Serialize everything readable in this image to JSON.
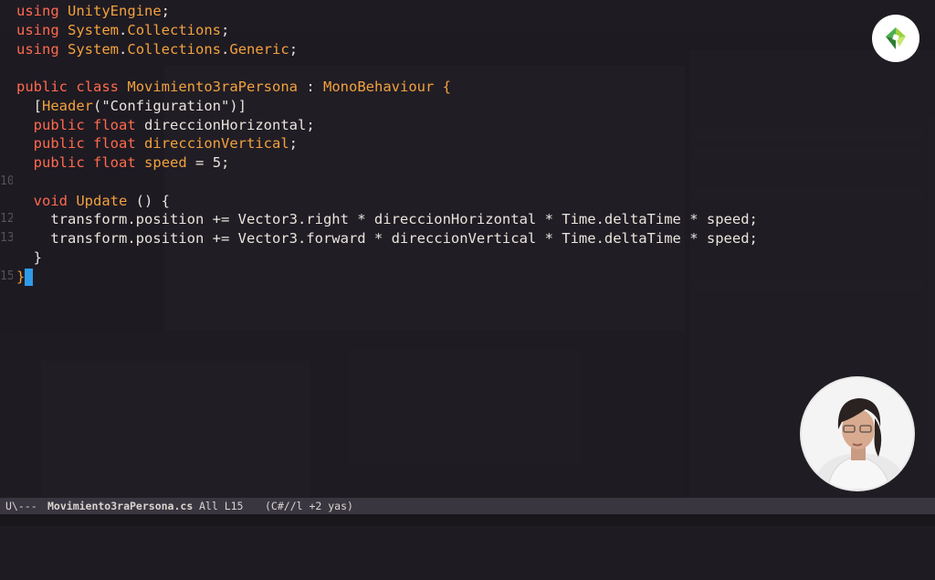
{
  "code_lines": [
    [
      {
        "t": "using",
        "c": "kw"
      },
      {
        "t": " ",
        "c": "nm"
      },
      {
        "t": "UnityEngine",
        "c": "ty"
      },
      {
        "t": ";",
        "c": "nm"
      }
    ],
    [
      {
        "t": "using",
        "c": "kw"
      },
      {
        "t": " ",
        "c": "nm"
      },
      {
        "t": "System",
        "c": "ty"
      },
      {
        "t": ".",
        "c": "nm"
      },
      {
        "t": "Collections",
        "c": "ty"
      },
      {
        "t": ";",
        "c": "nm"
      }
    ],
    [
      {
        "t": "using",
        "c": "kw"
      },
      {
        "t": " ",
        "c": "nm"
      },
      {
        "t": "System",
        "c": "ty"
      },
      {
        "t": ".",
        "c": "nm"
      },
      {
        "t": "Collections",
        "c": "ty"
      },
      {
        "t": ".",
        "c": "nm"
      },
      {
        "t": "Generic",
        "c": "ty"
      },
      {
        "t": ";",
        "c": "nm"
      }
    ],
    [],
    [
      {
        "t": "public",
        "c": "kw"
      },
      {
        "t": " ",
        "c": "nm"
      },
      {
        "t": "class",
        "c": "kw"
      },
      {
        "t": " ",
        "c": "nm"
      },
      {
        "t": "Movimiento3raPersona",
        "c": "ty"
      },
      {
        "t": " : ",
        "c": "nm"
      },
      {
        "t": "MonoBehaviour",
        "c": "ty"
      },
      {
        "t": " {",
        "c": "ty"
      }
    ],
    [
      {
        "t": "  [",
        "c": "nm"
      },
      {
        "t": "Header",
        "c": "ty"
      },
      {
        "t": "(\"Configuration\")]",
        "c": "nm"
      }
    ],
    [
      {
        "t": "  ",
        "c": "nm"
      },
      {
        "t": "public",
        "c": "kw"
      },
      {
        "t": " ",
        "c": "nm"
      },
      {
        "t": "float",
        "c": "kw"
      },
      {
        "t": " direccionHorizontal;",
        "c": "nm"
      }
    ],
    [
      {
        "t": "  ",
        "c": "nm"
      },
      {
        "t": "public",
        "c": "kw"
      },
      {
        "t": " ",
        "c": "nm"
      },
      {
        "t": "float",
        "c": "kw"
      },
      {
        "t": " ",
        "c": "nm"
      },
      {
        "t": "direccionVertical",
        "c": "var"
      },
      {
        "t": ";",
        "c": "nm"
      }
    ],
    [
      {
        "t": "  ",
        "c": "nm"
      },
      {
        "t": "public",
        "c": "kw"
      },
      {
        "t": " ",
        "c": "nm"
      },
      {
        "t": "float",
        "c": "kw"
      },
      {
        "t": " ",
        "c": "nm"
      },
      {
        "t": "speed",
        "c": "var"
      },
      {
        "t": " = 5;",
        "c": "nm"
      }
    ],
    [],
    [
      {
        "t": "  ",
        "c": "nm"
      },
      {
        "t": "void",
        "c": "kw"
      },
      {
        "t": " ",
        "c": "nm"
      },
      {
        "t": "Update",
        "c": "ty"
      },
      {
        "t": " () {",
        "c": "nm"
      }
    ],
    [
      {
        "t": "    transform.position += Vector3.right * direccionHorizontal * Time.deltaTime * speed;",
        "c": "nm"
      }
    ],
    [
      {
        "t": "    transform.position += Vector3.forward * direccionVertical * Time.deltaTime * speed;",
        "c": "nm"
      }
    ],
    [
      {
        "t": "  }",
        "c": "nm"
      }
    ],
    [
      {
        "t": "}",
        "c": "ty"
      },
      {
        "t": "CURSOR",
        "c": "cursor"
      }
    ]
  ],
  "gutter": [
    "",
    "",
    "",
    "",
    "",
    "",
    "",
    "",
    "",
    "10",
    "",
    "12",
    "13",
    "",
    "15"
  ],
  "modeline": {
    "state": "U\\---",
    "filename": "Movimiento3raPersona.cs",
    "position": "All L15",
    "mode": "(C#//l +2 yas)"
  },
  "logo_icon": "brand-logo-icon",
  "avatar_icon": "presenter-webcam"
}
